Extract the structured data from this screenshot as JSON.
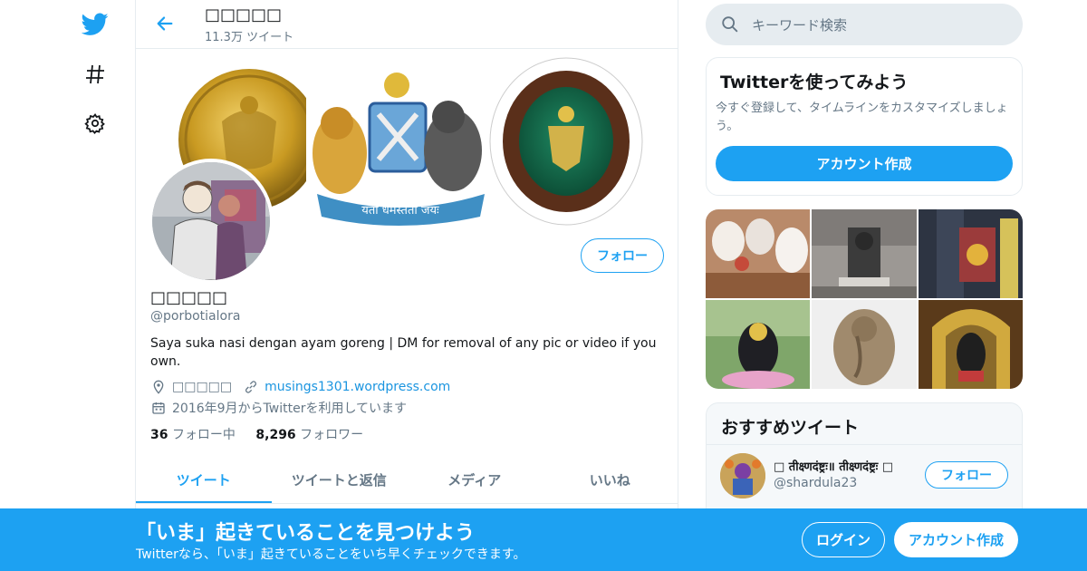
{
  "nav": {
    "items": [
      {
        "icon": "twitter-bird-icon"
      },
      {
        "icon": "hashtag-icon"
      },
      {
        "icon": "gear-icon"
      }
    ]
  },
  "header": {
    "name": "□□□□□",
    "tweet_count": "11.3万 ツイート"
  },
  "profile": {
    "name": "□□□□□",
    "handle": "@porbotialora",
    "bio": "Saya suka nasi dengan ayam goreng | DM for removal of any pic or video if you own.",
    "location": "□□□□□",
    "website": "musings1301.wordpress.com",
    "joined": "2016年9月からTwitterを利用しています",
    "following_count": "36",
    "following_label": "フォロー中",
    "followers_count": "8,296",
    "followers_label": "フォロワー",
    "follow_button": "フォロー",
    "banner_motto": "यतो धर्मस्ततो जयः"
  },
  "tabs": [
    {
      "label": "ツイート",
      "active": true
    },
    {
      "label": "ツイートと返信",
      "active": false
    },
    {
      "label": "メディア",
      "active": false
    },
    {
      "label": "いいね",
      "active": false
    }
  ],
  "search": {
    "placeholder": "キーワード検索"
  },
  "signup_card": {
    "title": "Twitterを使ってみよう",
    "description": "今すぐ登録して、タイムラインをカスタマイズしましょう。",
    "button": "アカウント作成"
  },
  "recommended": {
    "title": "おすすめツイート",
    "name": "□ तीक्ष्णदंष्ट्रः॥ तीक्ष्णदंष्ट्रः □",
    "handle": "@shardula23",
    "follow_button": "フォロー"
  },
  "bottom_bar": {
    "title": "「いま」起きていることを見つけよう",
    "subtitle": "Twitterなら、「いま」起きていることをいち早くチェックできます。",
    "login_button": "ログイン",
    "signup_button": "アカウント作成"
  },
  "colors": {
    "accent": "#1da1f2",
    "text_secondary": "#657786",
    "border": "#e6ecf0"
  }
}
